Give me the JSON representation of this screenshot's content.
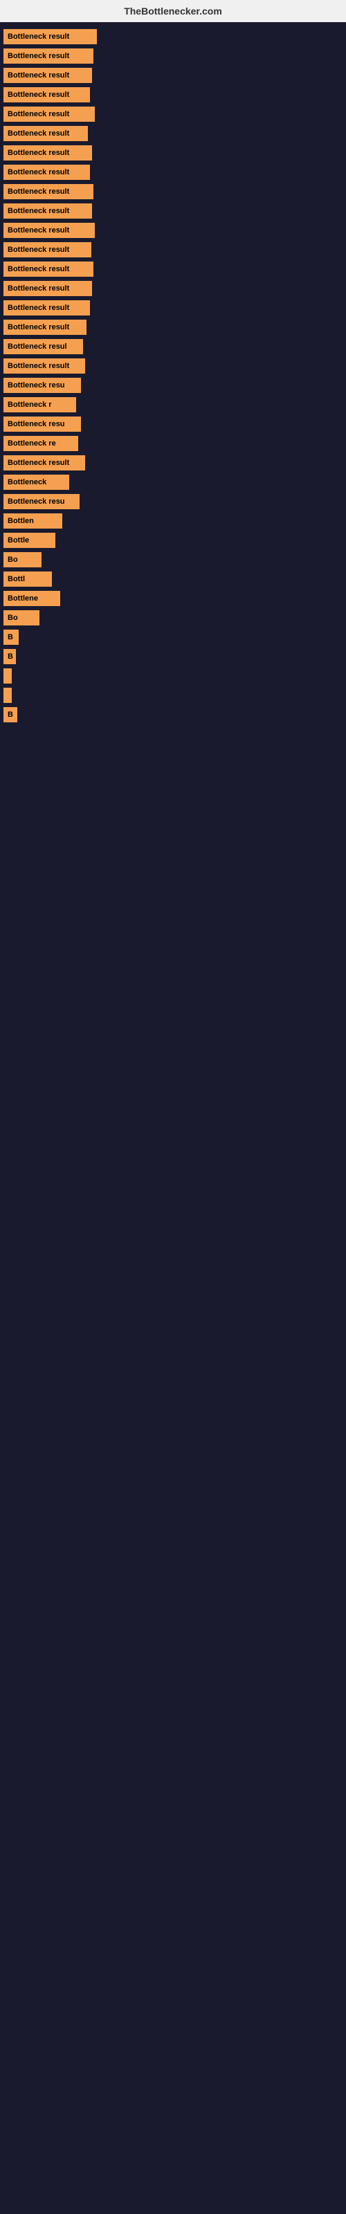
{
  "site_title": "TheBottlenecker.com",
  "bars": [
    {
      "label": "Bottleneck result",
      "width": 135
    },
    {
      "label": "Bottleneck result",
      "width": 130
    },
    {
      "label": "Bottleneck result",
      "width": 128
    },
    {
      "label": "Bottleneck result",
      "width": 125
    },
    {
      "label": "Bottleneck result",
      "width": 132
    },
    {
      "label": "Bottleneck result",
      "width": 122
    },
    {
      "label": "Bottleneck result",
      "width": 128
    },
    {
      "label": "Bottleneck result",
      "width": 125
    },
    {
      "label": "Bottleneck result",
      "width": 130
    },
    {
      "label": "Bottleneck result",
      "width": 128
    },
    {
      "label": "Bottleneck result",
      "width": 132
    },
    {
      "label": "Bottleneck result",
      "width": 127
    },
    {
      "label": "Bottleneck result",
      "width": 130
    },
    {
      "label": "Bottleneck result",
      "width": 128
    },
    {
      "label": "Bottleneck result",
      "width": 125
    },
    {
      "label": "Bottleneck result",
      "width": 120
    },
    {
      "label": "Bottleneck resul",
      "width": 115
    },
    {
      "label": "Bottleneck result",
      "width": 118
    },
    {
      "label": "Bottleneck resu",
      "width": 112
    },
    {
      "label": "Bottleneck r",
      "width": 105
    },
    {
      "label": "Bottleneck resu",
      "width": 112
    },
    {
      "label": "Bottleneck re",
      "width": 108
    },
    {
      "label": "Bottleneck result",
      "width": 118
    },
    {
      "label": "Bottleneck",
      "width": 95
    },
    {
      "label": "Bottleneck resu",
      "width": 110
    },
    {
      "label": "Bottlen",
      "width": 85
    },
    {
      "label": "Bottle",
      "width": 75
    },
    {
      "label": "Bo",
      "width": 55
    },
    {
      "label": "Bottl",
      "width": 70
    },
    {
      "label": "Bottlene",
      "width": 82
    },
    {
      "label": "Bo",
      "width": 52
    },
    {
      "label": "B",
      "width": 22
    },
    {
      "label": "B",
      "width": 18
    },
    {
      "label": "",
      "width": 12
    },
    {
      "label": "",
      "width": 8
    },
    {
      "label": "B",
      "width": 20
    }
  ]
}
